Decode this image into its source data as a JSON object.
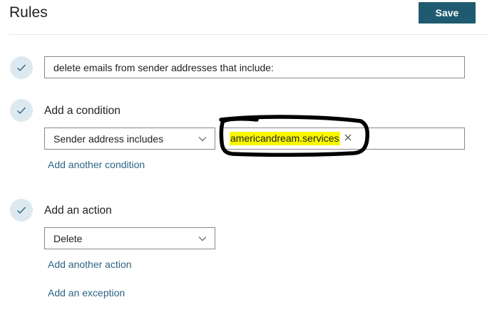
{
  "header": {
    "title": "Rules",
    "save_label": "Save"
  },
  "rule_name": {
    "value": "delete emails from sender addresses that include:"
  },
  "condition": {
    "heading": "Add a condition",
    "dropdown_value": "Sender address includes",
    "tag_value": "americandream.services",
    "add_another_label": "Add another condition"
  },
  "action": {
    "heading": "Add an action",
    "dropdown_value": "Delete",
    "add_another_label": "Add another action",
    "add_exception_label": "Add an exception"
  },
  "icons": {
    "check": "checkmark-icon",
    "chevron": "chevron-down-icon",
    "remove": "close-icon"
  },
  "colors": {
    "accent": "#1f5b70",
    "link": "#2b6584",
    "check_circle": "#dde9f0",
    "highlight": "#f7f700"
  }
}
